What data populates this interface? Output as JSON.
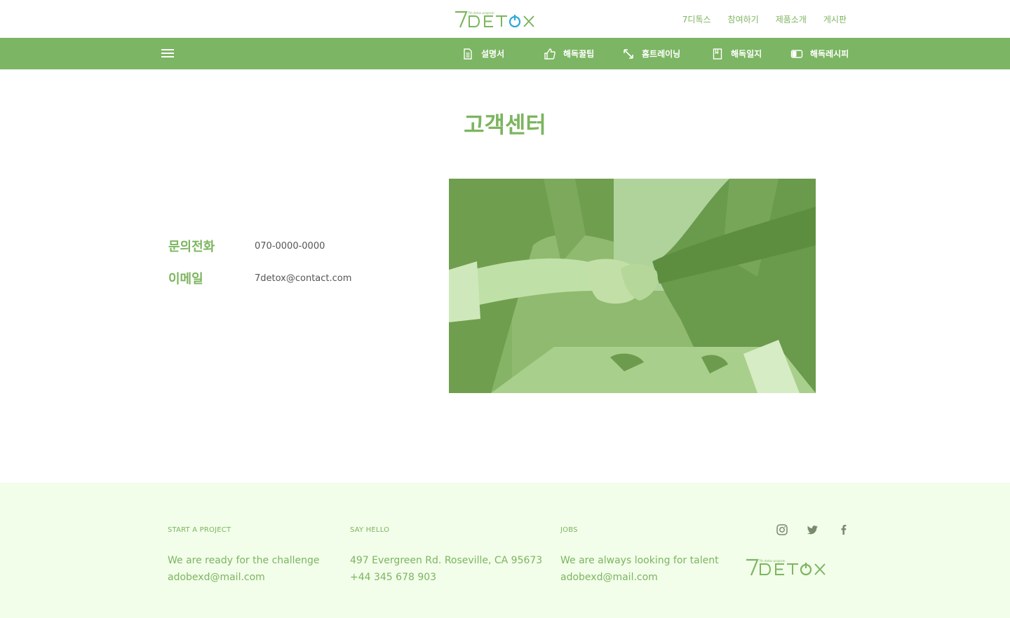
{
  "brand": {
    "logo_text": "7DETOX",
    "logo_tagline": "7th detox program",
    "primary_color": "#7cb563",
    "accent_color": "#2aa9d8"
  },
  "top_nav": {
    "items": [
      "7디톡스",
      "참여하기",
      "제품소개",
      "게시판"
    ]
  },
  "sub_nav": {
    "items": [
      {
        "label": "설명서",
        "icon": "document-icon"
      },
      {
        "label": "해독꿀팁",
        "icon": "thumbs-up-icon"
      },
      {
        "label": "홈트레이닝",
        "icon": "resize-arrows-icon"
      },
      {
        "label": "해독일지",
        "icon": "bookmark-icon"
      },
      {
        "label": "해독레시피",
        "icon": "toggle-icon"
      }
    ]
  },
  "page": {
    "title": "고객센터"
  },
  "contact": {
    "phone_label": "문의전화",
    "phone_value": "070-0000-0000",
    "email_label": "이메일",
    "email_value": "7detox@contact.com"
  },
  "image": {
    "subject": "handshake-photo"
  },
  "footer": {
    "columns": [
      {
        "heading": "START A PROJECT",
        "lines": [
          "We are ready for the challenge",
          "adobexd@mail.com"
        ]
      },
      {
        "heading": "SAY HELLO",
        "lines": [
          "497 Evergreen Rd. Roseville, CA 95673",
          "+44 345 678 903"
        ]
      },
      {
        "heading": "JOBS",
        "lines": [
          "We are always looking for talent",
          "adobexd@mail.com"
        ]
      }
    ],
    "social": [
      "instagram-icon",
      "twitter-icon",
      "facebook-icon"
    ]
  }
}
